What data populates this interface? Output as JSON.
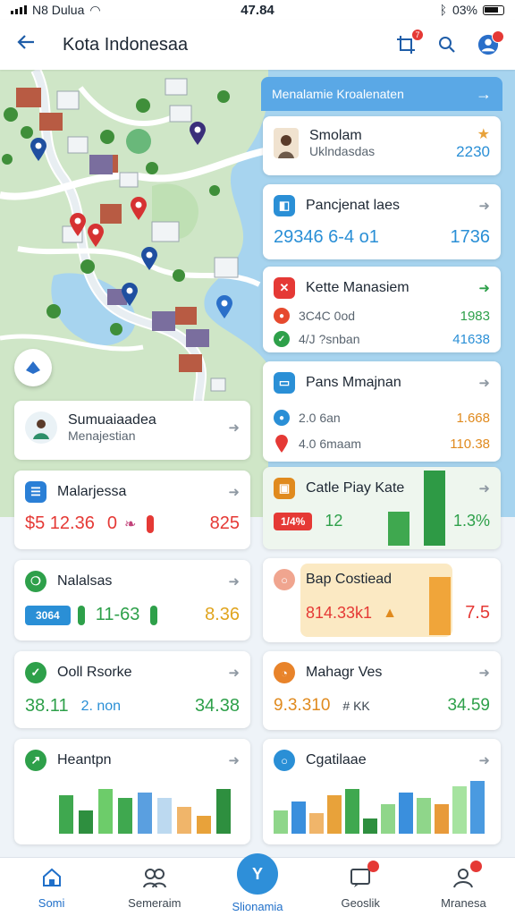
{
  "status": {
    "carrier": "N8 Dulua",
    "time": "47.84",
    "battery": "03%"
  },
  "appbar": {
    "title": "Kota Indonesaa",
    "badge_count": "7"
  },
  "banner": {
    "label": "Menalamie Kroalenaten",
    "arrow": "→"
  },
  "right_cards": [
    {
      "title": "Smolam",
      "subtitle": "Uklndasdas",
      "value": "2230",
      "icon_color": "#e8a23a",
      "value_color": "#2a8fd6"
    },
    {
      "title": "Pancjenat laes",
      "value_a": "29346 6-4 o1",
      "value_b": "1736",
      "icon_color": "#2a8fd6"
    },
    {
      "title": "Kette Manasiem",
      "items": [
        {
          "label": "3C4C 0od",
          "value": "1983",
          "color": "#e64a2e",
          "value_color": "#2ea04a"
        },
        {
          "label": "4/J ?snban",
          "value": "41638",
          "color": "#2ea04a",
          "value_color": "#2a8fd6"
        }
      ],
      "icon_color": "#e53935"
    },
    {
      "title": "Pans Mmajnan",
      "items": [
        {
          "label": "2.0 6an",
          "value": "1.668",
          "color": "#2a8fd6",
          "value_color": "#e08a1e"
        },
        {
          "label": "4.0 6maam",
          "value": "110.38",
          "color": "#e53935",
          "value_color": "#e08a1e"
        }
      ],
      "icon_color": "#2a8fd6"
    },
    {
      "title": "Catle Piay Kate",
      "pill": "1/4%",
      "value_a": "12",
      "value_b": "1.3%",
      "icon_color": "#e08a1e",
      "bar_values": [
        0.45,
        1.0
      ]
    },
    {
      "title": "Bap Costiead",
      "value_a": "814.33k1",
      "value_b": "7.5",
      "icon_color": "#f0a58f",
      "bar_values": [
        0.85
      ]
    },
    {
      "title": "Mahagr Ves",
      "value_a": "9.3.310",
      "value_b": "# KK",
      "value_c": "34.59",
      "icon_color": "#e8832a"
    },
    {
      "title": "Cgatilaae",
      "icon_color": "#2a8fd6",
      "bar_values": [
        0.4,
        0.55,
        0.35,
        0.65,
        0.75,
        0.25,
        0.5,
        0.7,
        0.6,
        0.5,
        0.8,
        0.9
      ]
    }
  ],
  "left_cards": [
    {
      "title": "Sumuaiaadea",
      "subtitle": "Menajestian"
    },
    {
      "title": "Malarjessa",
      "value_a": "$5 12.36",
      "value_b": "0",
      "value_c": "825",
      "icon_color": "#2a7fd6"
    },
    {
      "title": "Nalalsas",
      "pill": "3064",
      "value_a": "11-63",
      "value_b": "8.36",
      "icon_color": "#2ea04a"
    },
    {
      "title": "Ooll Rsorke",
      "value_a": "38.11",
      "value_b": "2. non",
      "value_c": "34.38",
      "icon_color": "#2ea04a"
    },
    {
      "title": "Heantpn",
      "icon_color": "#2ea04a",
      "bar_values": [
        0.65,
        0.4,
        0.75,
        0.6,
        0.7,
        0.6,
        0.45,
        0.3,
        0.75
      ]
    }
  ],
  "tabs": [
    {
      "label": "Somi",
      "active": true
    },
    {
      "label": "Semeraim",
      "active": false
    },
    {
      "label": "Slionamia",
      "active": true
    },
    {
      "label": "Geoslik",
      "active": false
    },
    {
      "label": "Mranesa",
      "active": false
    }
  ],
  "icons": [
    "back-icon",
    "crop-icon",
    "search-icon",
    "avatar-icon",
    "compass-icon",
    "chevron-right-icon",
    "star-icon",
    "home-icon",
    "people-icon",
    "chat-icon",
    "person-icon"
  ]
}
